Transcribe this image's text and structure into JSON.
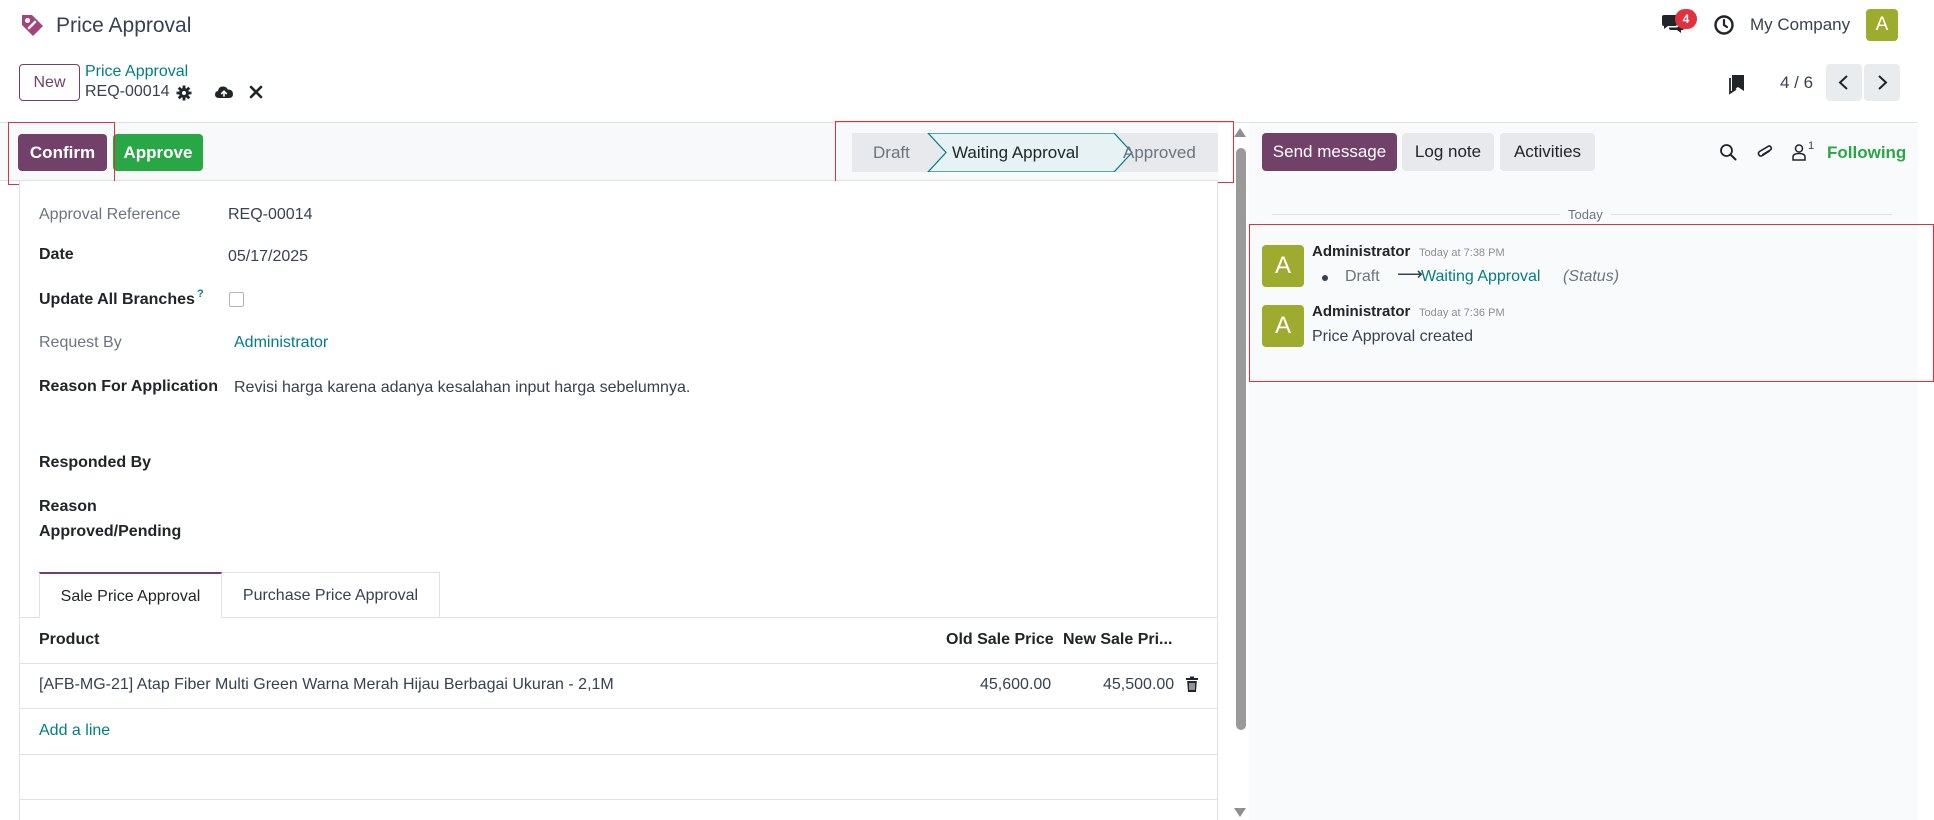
{
  "app": {
    "title": "Price Approval",
    "logo_icon": "tag-icon"
  },
  "navbar": {
    "messages_count": "4",
    "company": "My Company",
    "avatar_initial": "A",
    "colors": {
      "badge": "#e0323d",
      "avatar": "#9dab2f"
    }
  },
  "control_panel": {
    "new_label": "New",
    "breadcrumb_parent": "Price Approval",
    "breadcrumb_current": "REQ-00014",
    "pager_value": "4 / 6"
  },
  "statusbar": {
    "confirm_label": "Confirm",
    "approve_label": "Approve",
    "stages": [
      {
        "label": "Draft",
        "active": false
      },
      {
        "label": "Waiting Approval",
        "active": true
      },
      {
        "label": "Approved",
        "active": false
      }
    ]
  },
  "form": {
    "approval_reference": {
      "label": "Approval Reference",
      "value": "REQ-00014"
    },
    "date": {
      "label": "Date",
      "value": "05/17/2025"
    },
    "update_all_branches": {
      "label": "Update All Branches",
      "help": "?",
      "checked": false
    },
    "request_by": {
      "label": "Request By",
      "value": "Administrator"
    },
    "reason_for_application": {
      "label": "Reason For Application",
      "value": "Revisi harga karena adanya kesalahan input harga sebelumnya."
    },
    "responded_by": {
      "label": "Responded By",
      "value": ""
    },
    "reason_approved_pending": {
      "label_line1": "Reason",
      "label_line2": "Approved/Pending",
      "value": ""
    }
  },
  "tabs": [
    {
      "label": "Sale Price Approval",
      "active": true
    },
    {
      "label": "Purchase Price Approval",
      "active": false
    }
  ],
  "lines_table": {
    "columns": [
      "Product",
      "Old Sale Price",
      "New Sale Pri..."
    ],
    "rows": [
      {
        "product": "[AFB-MG-21] Atap Fiber Multi Green Warna Merah Hijau Berbagai Ukuran - 2,1M",
        "old_price": "45,600.00",
        "new_price": "45,500.00"
      }
    ],
    "add_line_label": "Add a line"
  },
  "chatter": {
    "send_message_label": "Send message",
    "log_note_label": "Log note",
    "activities_label": "Activities",
    "followers_count": "1",
    "following_label": "Following",
    "date_separator": "Today",
    "messages": [
      {
        "avatar": "A",
        "author": "Administrator",
        "time": "Today at 7:38 PM",
        "tracking_old": "Draft",
        "tracking_new": "Waiting Approval",
        "tracking_field": "(Status)"
      },
      {
        "avatar": "A",
        "author": "Administrator",
        "time": "Today at 7:36 PM",
        "body": "Price Approval created"
      }
    ]
  },
  "colors": {
    "primary": "#71416a",
    "success": "#28a745",
    "link": "#017e84",
    "highlight_box": "#e0323d"
  }
}
